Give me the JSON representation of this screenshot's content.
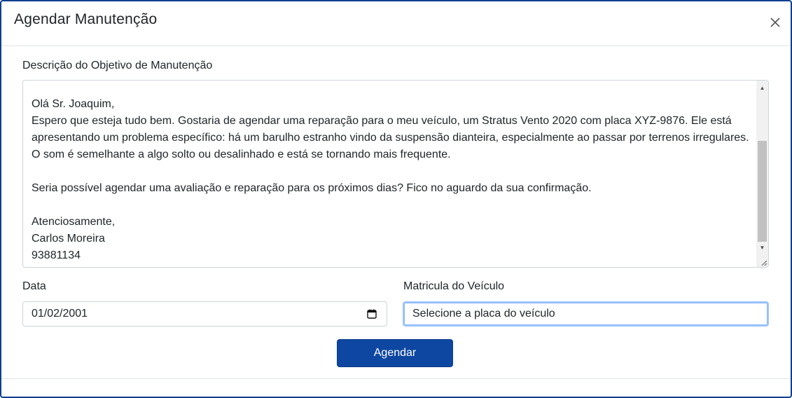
{
  "modal": {
    "title": "Agendar Manutenção",
    "close_label": "×"
  },
  "description": {
    "label": "Descrição do Objetivo de Manutenção",
    "value": "Olá Sr. Joaquim,\nEspero que esteja tudo bem. Gostaria de agendar uma reparação para o meu veículo, um Stratus Vento 2020 com placa XYZ-9876. Ele está apresentando um problema específico: há um barulho estranho vindo da suspensão dianteira, especialmente ao passar por terrenos irregulares. O som é semelhante a algo solto ou desalinhado e está se tornando mais frequente.\n\nSeria possível agendar uma avaliação e reparação para os próximos dias? Fico no aguardo da sua confirmação.\n\nAtenciosamente,\nCarlos Moreira\n93881134"
  },
  "date": {
    "label": "Data",
    "value": "01/02/2001"
  },
  "vehicle": {
    "label": "Matricula do Veículo",
    "placeholder": "Selecione a placa do veículo"
  },
  "submit": {
    "label": "Agendar"
  },
  "colors": {
    "border": "#0d3f8f",
    "button": "#0d47a1",
    "focus": "#9ec5fe"
  },
  "icons": [
    "close-icon",
    "calendar-icon",
    "scroll-up-icon",
    "scroll-down-icon",
    "resize-grip-icon"
  ]
}
